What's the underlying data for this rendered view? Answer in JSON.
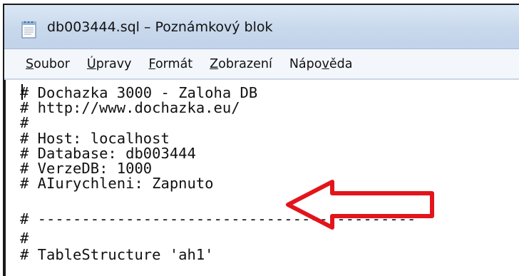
{
  "window": {
    "title": "db003444.sql – Poznámkový blok",
    "icon": "notepad-icon"
  },
  "menu": [
    {
      "pre": "",
      "mnemonic": "S",
      "post": "oubor"
    },
    {
      "pre": "",
      "mnemonic": "Ú",
      "post": "pravy"
    },
    {
      "pre": "",
      "mnemonic": "F",
      "post": "ormát"
    },
    {
      "pre": "",
      "mnemonic": "Z",
      "post": "obrazení"
    },
    {
      "pre": "Nápo",
      "mnemonic": "v",
      "post": "ěda"
    }
  ],
  "editor": {
    "lines": [
      "# Dochazka 3000 - Zaloha DB",
      "# http://www.dochazka.eu/",
      "#",
      "# Host: localhost",
      "# Database: db003444",
      "# VerzeDB: 1000",
      "# AIurychleni: Zapnuto",
      "",
      "# -------------------------------------------",
      "#",
      "# TableStructure 'ah1'"
    ]
  },
  "annotation": {
    "arrow_color": "#e3141b",
    "arrow_direction": "left"
  }
}
